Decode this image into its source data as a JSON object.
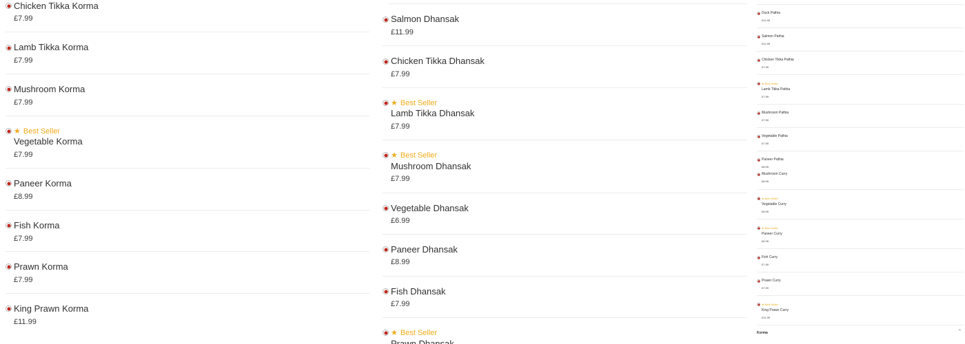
{
  "badge_label": "Best Seller",
  "colors": {
    "veg_dot": "#c0251c",
    "best_seller": "#f0ab1b",
    "divider": "#ececec"
  },
  "icons": {
    "badge_icon": "star-icon",
    "dot_icon": "veg-indicator-icon",
    "collapse_icon": "chevron-up-icon"
  },
  "columns": [
    {
      "items": [
        {
          "name": "Chicken Tikka Korma",
          "price": "£7.99",
          "best_seller": false
        },
        {
          "name": "Lamb Tikka Korma",
          "price": "£7.99",
          "best_seller": false
        },
        {
          "name": "Mushroom Korma",
          "price": "£7.99",
          "best_seller": false
        },
        {
          "name": "Vegetable Korma",
          "price": "£7.99",
          "best_seller": true
        },
        {
          "name": "Paneer Korma",
          "price": "£8.99",
          "best_seller": false
        },
        {
          "name": "Fish Korma",
          "price": "£7.99",
          "best_seller": false
        },
        {
          "name": "Prawn Korma",
          "price": "£7.99",
          "best_seller": false
        },
        {
          "name": "King Prawn Korma",
          "price": "£11.99",
          "best_seller": false
        }
      ]
    },
    {
      "items": [
        {
          "name": "Salmon Dhansak",
          "price": "£11.99",
          "best_seller": false
        },
        {
          "name": "Chicken Tikka Dhansak",
          "price": "£7.99",
          "best_seller": false
        },
        {
          "name": "Lamb Tikka Dhansak",
          "price": "£7.99",
          "best_seller": true
        },
        {
          "name": "Mushroom Dhansak",
          "price": "£7.99",
          "best_seller": true
        },
        {
          "name": "Vegetable Dhansak",
          "price": "£6.99",
          "best_seller": false
        },
        {
          "name": "Paneer Dhansak",
          "price": "£8.99",
          "best_seller": false
        },
        {
          "name": "Fish Dhansak",
          "price": "£7.99",
          "best_seller": false
        },
        {
          "name": "Prawn Dhansak",
          "price": "",
          "best_seller": true
        }
      ]
    },
    {
      "items": [
        {
          "name": "Duck Pathia",
          "price": "£11.99",
          "best_seller": false
        },
        {
          "name": "Salmon Pathia",
          "price": "£11.99",
          "best_seller": false
        },
        {
          "name": "Chicken Tikka Pathia",
          "price": "£7.99",
          "best_seller": false
        },
        {
          "name": "Lamb Tikka Pathia",
          "price": "£7.99",
          "best_seller": true
        },
        {
          "name": "Mushroom Pathia",
          "price": "£7.99",
          "best_seller": false
        },
        {
          "name": "Vegetable Pathia",
          "price": "£7.99",
          "best_seller": false
        },
        {
          "name": "Paneer Pathia",
          "price": "£8.99",
          "best_seller": false
        },
        {
          "name": "Mushroom Curry",
          "price": "£6.99",
          "best_seller": false
        },
        {
          "name": "Vegetable Curry",
          "price": "£6.99",
          "best_seller": true
        },
        {
          "name": "Paneer Curry",
          "price": "£6.99",
          "best_seller": true
        },
        {
          "name": "Fish Curry",
          "price": "£7.99",
          "best_seller": false
        },
        {
          "name": "Prawn Curry",
          "price": "£7.99",
          "best_seller": false
        },
        {
          "name": "King Prawn Curry",
          "price": "£11.99",
          "best_seller": true
        }
      ]
    }
  ],
  "section_header": {
    "label": "Korma"
  }
}
